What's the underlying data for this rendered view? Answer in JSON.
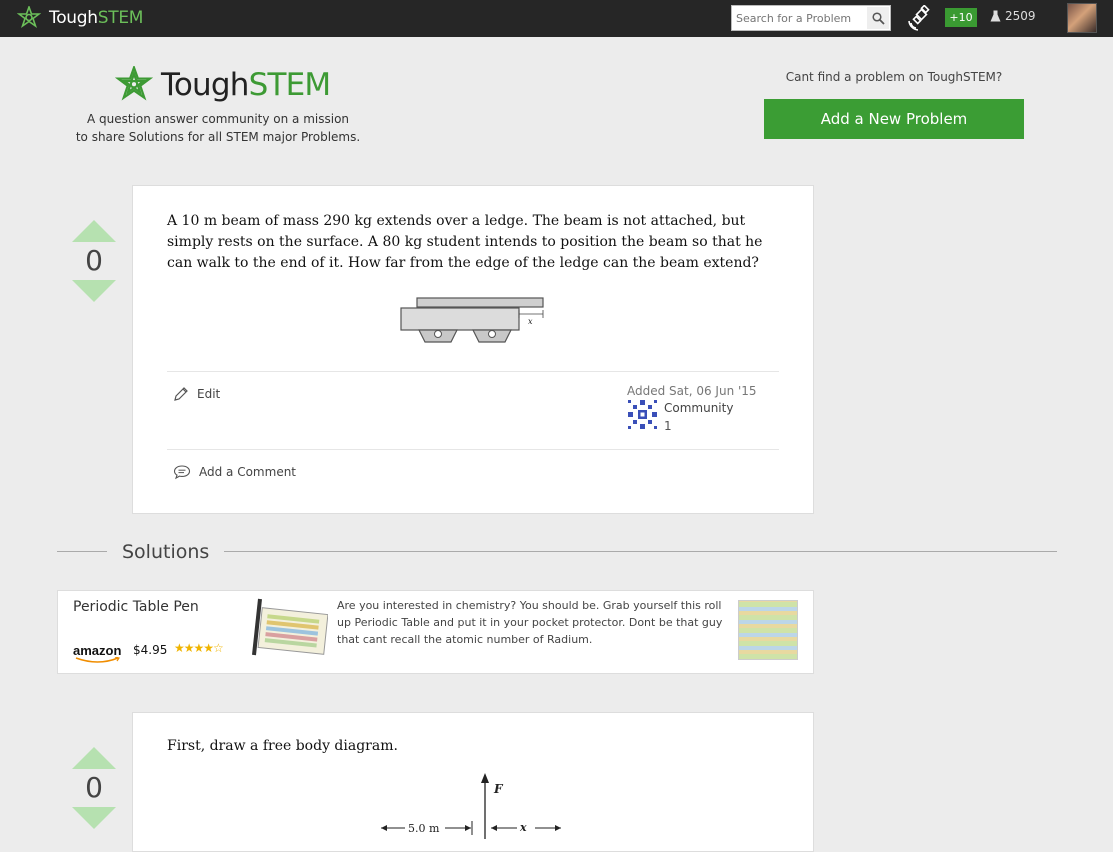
{
  "topbar": {
    "brand_tough": "Tough",
    "brand_stem": "STEM",
    "search_placeholder": "Search for a Problem",
    "points_badge": "+10",
    "score": "2509"
  },
  "header": {
    "logo_tough": "Tough",
    "logo_stem": "STEM",
    "tagline_line1": "A question answer community on a mission",
    "tagline_line2": "to share Solutions for all STEM major Problems.",
    "cant_find": "Cant find a problem on ToughSTEM?",
    "add_problem_label": "Add a New Problem"
  },
  "question": {
    "votes": "0",
    "text": "A 10 m beam of mass 290 kg extends over a ledge. The beam is not attached, but simply rests on the surface. A 80 kg student intends to position the beam so that he can walk to the end of it. How far from the edge of the ledge can the beam extend?",
    "figure_label": "x",
    "edit_label": "Edit",
    "added": "Added Sat, 06 Jun '15",
    "author": "Community",
    "author_score": "1",
    "comment_label": "Add a Comment"
  },
  "solutions": {
    "heading": "Solutions"
  },
  "ad": {
    "product_name": "Periodic Table Pen",
    "brand": "amazon",
    "price": "$4.95",
    "rating_stars": "★★★★☆",
    "description": "Are you interested in chemistry? You should be. Grab yourself this roll up Periodic Table and put it in your pocket protector. Dont be that guy that cant recall the atomic number of Radium."
  },
  "solution1": {
    "votes": "0",
    "text": "First, draw a free body diagram.",
    "fbd_force": "F",
    "fbd_dist": "5.0 m",
    "fbd_x": "x"
  },
  "colors": {
    "brand_green": "#3b9d34",
    "vote_arrow": "#b6e1b0",
    "topbar": "#262626"
  }
}
